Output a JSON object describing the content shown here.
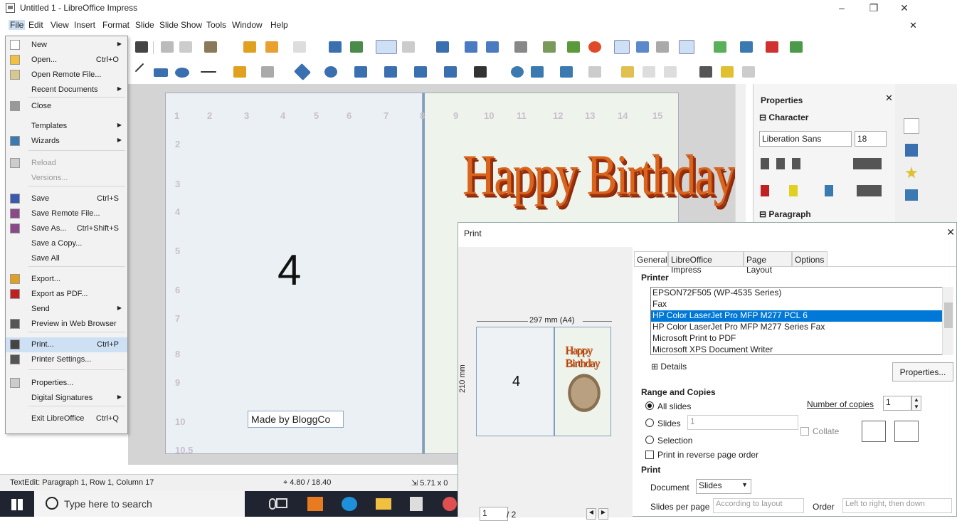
{
  "window": {
    "title": "Untitled 1 - LibreOffice Impress",
    "minimize": "–",
    "restore": "❐",
    "close": "✕",
    "doc_close": "✕"
  },
  "menubar": [
    {
      "label": "File",
      "mnemonic": "F"
    },
    {
      "label": "Edit"
    },
    {
      "label": "View"
    },
    {
      "label": "Insert"
    },
    {
      "label": "Format"
    },
    {
      "label": "Slide"
    },
    {
      "label": "Slide Show"
    },
    {
      "label": "Tools"
    },
    {
      "label": "Window"
    },
    {
      "label": "Help"
    }
  ],
  "file_menu": [
    {
      "label": "New",
      "submenu": true
    },
    {
      "label": "Open...",
      "shortcut": "Ctrl+O"
    },
    {
      "label": "Open Remote File..."
    },
    {
      "label": "Recent Documents",
      "submenu": true
    },
    {
      "label": "Close"
    },
    {
      "label": "Templates",
      "submenu": true
    },
    {
      "label": "Wizards",
      "submenu": true
    },
    {
      "label": "Reload",
      "disabled": true
    },
    {
      "label": "Versions...",
      "disabled": true
    },
    {
      "label": "Save",
      "shortcut": "Ctrl+S"
    },
    {
      "label": "Save Remote File..."
    },
    {
      "label": "Save As...",
      "shortcut": "Ctrl+Shift+S"
    },
    {
      "label": "Save a Copy..."
    },
    {
      "label": "Save All"
    },
    {
      "label": "Export..."
    },
    {
      "label": "Export as PDF..."
    },
    {
      "label": "Send",
      "submenu": true
    },
    {
      "label": "Preview in Web Browser"
    },
    {
      "label": "Print...",
      "shortcut": "Ctrl+P",
      "highlighted": true
    },
    {
      "label": "Printer Settings..."
    },
    {
      "label": "Properties..."
    },
    {
      "label": "Digital Signatures",
      "submenu": true
    },
    {
      "label": "Exit LibreOffice",
      "shortcut": "Ctrl+Q"
    }
  ],
  "slide": {
    "left_numbers": [
      "1",
      "2",
      "3",
      "4",
      "5",
      "6",
      "7"
    ],
    "right_numbers": [
      "8",
      "9",
      "10",
      "11",
      "12",
      "13",
      "14",
      "15"
    ],
    "row_numbers": [
      "2",
      "3",
      "4",
      "5",
      "6",
      "7",
      "8",
      "9",
      "10",
      "10.5"
    ],
    "big_number": "4",
    "made_by": "Made by BloggCo",
    "happy_birthday": "Happy Birthday"
  },
  "properties_panel": {
    "title": "Properties",
    "character": "Character",
    "font_name": "Liberation Sans",
    "font_size": "18",
    "paragraph": "Paragraph"
  },
  "statusbar": {
    "edit_info": "TextEdit: Paragraph 1, Row 1, Column 17",
    "position": "4.80 / 18.40",
    "size": "5.71 x 0"
  },
  "taskbar": {
    "search_placeholder": "Type here to search"
  },
  "print_dialog": {
    "title": "Print",
    "tabs": [
      "General",
      "LibreOffice Impress",
      "Page Layout",
      "Options"
    ],
    "printer_header": "Printer",
    "printers": [
      "EPSON72F505 (WP-4535 Series)",
      "Fax",
      "HP Color LaserJet Pro MFP M277 PCL 6",
      "HP Color LaserJet Pro MFP M277 Series Fax",
      "Microsoft Print to PDF",
      "Microsoft XPS Document Writer"
    ],
    "selected_printer_index": 2,
    "details": "Details",
    "properties_btn": "Properties...",
    "preview_width": "297 mm (A4)",
    "preview_height": "210 mm",
    "preview_number": "4",
    "preview_birthday": "Happy Birthday",
    "page_counter": "1",
    "page_total": "/ 2",
    "range_header": "Range and Copies",
    "all_slides": "All slides",
    "slides": "Slides",
    "slides_value": "1",
    "selection": "Selection",
    "reverse": "Print in reverse page order",
    "copies_label": "Number of copies",
    "copies_value": "1",
    "collate": "Collate",
    "print_header": "Print",
    "document_label": "Document",
    "document_value": "Slides",
    "slides_per_page_label": "Slides per page",
    "slides_per_page_value": "According to layout",
    "order_label": "Order",
    "order_value": "Left to right, then down"
  }
}
